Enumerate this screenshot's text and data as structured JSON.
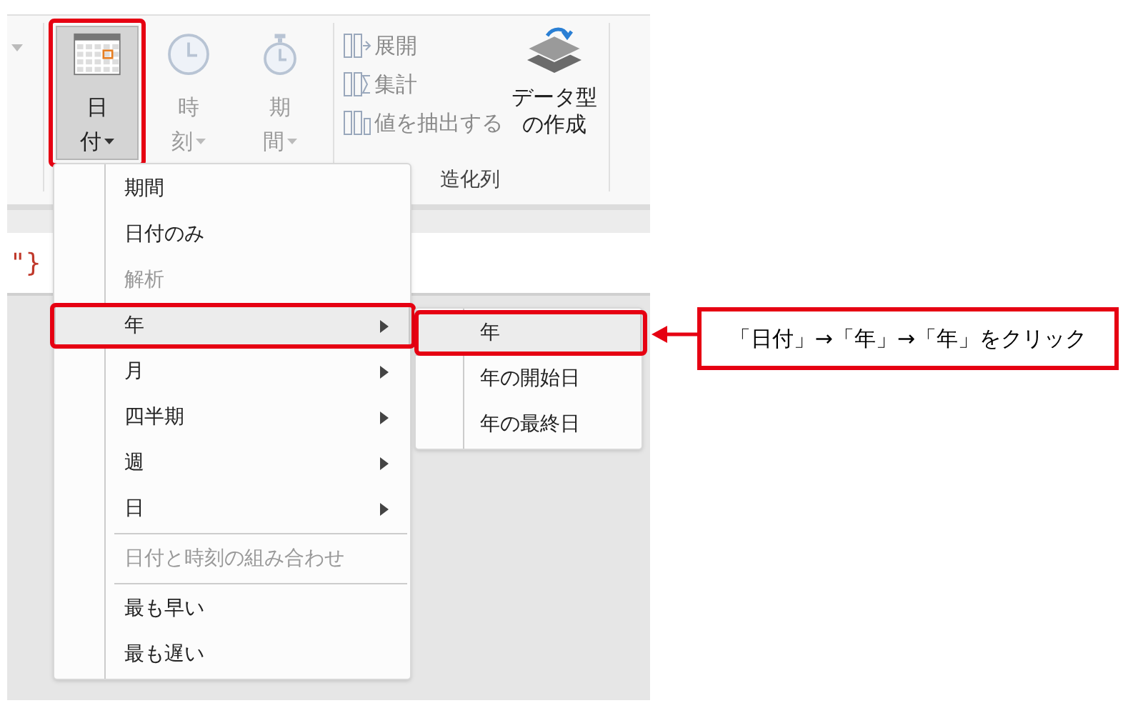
{
  "ribbon": {
    "buttons": [
      {
        "kind": "date",
        "label_lines": [
          "日",
          "付"
        ],
        "selected": true,
        "disabled": false
      },
      {
        "kind": "time",
        "label_lines": [
          "時",
          "刻"
        ],
        "selected": false,
        "disabled": true
      },
      {
        "kind": "duration",
        "label_lines": [
          "期",
          "間"
        ],
        "selected": false,
        "disabled": true
      }
    ],
    "structured_column": {
      "items": [
        {
          "kind": "expand",
          "label": "展開",
          "disabled": true
        },
        {
          "kind": "aggregate",
          "label": "集計",
          "disabled": true
        },
        {
          "kind": "extract",
          "label": "値を抽出する",
          "disabled": true
        }
      ],
      "create_button": {
        "label_lines": [
          "データ型",
          "の作成"
        ]
      },
      "group_label": "造化列"
    }
  },
  "formula_bar": {
    "text": "\"}"
  },
  "menu": {
    "items": [
      {
        "kind": "item",
        "label": "期間",
        "disabled": false,
        "selected": false
      },
      {
        "kind": "item",
        "label": "日付のみ",
        "disabled": false,
        "selected": false
      },
      {
        "kind": "item",
        "label": "解析",
        "disabled": true,
        "selected": false
      },
      {
        "kind": "submenu",
        "label": "年",
        "disabled": false,
        "selected": true
      },
      {
        "kind": "submenu",
        "label": "月",
        "disabled": false,
        "selected": false
      },
      {
        "kind": "submenu",
        "label": "四半期",
        "disabled": false,
        "selected": false
      },
      {
        "kind": "submenu",
        "label": "週",
        "disabled": false,
        "selected": false
      },
      {
        "kind": "submenu",
        "label": "日",
        "disabled": false,
        "selected": false
      },
      {
        "kind": "separator"
      },
      {
        "kind": "item",
        "label": "日付と時刻の組み合わせ",
        "disabled": true,
        "selected": false
      },
      {
        "kind": "separator"
      },
      {
        "kind": "item",
        "label": "最も早い",
        "disabled": false,
        "selected": false
      },
      {
        "kind": "item",
        "label": "最も遅い",
        "disabled": false,
        "selected": false
      }
    ]
  },
  "submenu": {
    "items": [
      {
        "label": "年",
        "selected": true
      },
      {
        "label": "年の開始日",
        "selected": false
      },
      {
        "label": "年の最終日",
        "selected": false
      }
    ]
  },
  "callout": {
    "text": "「日付」→「年」→「年」をクリック"
  }
}
